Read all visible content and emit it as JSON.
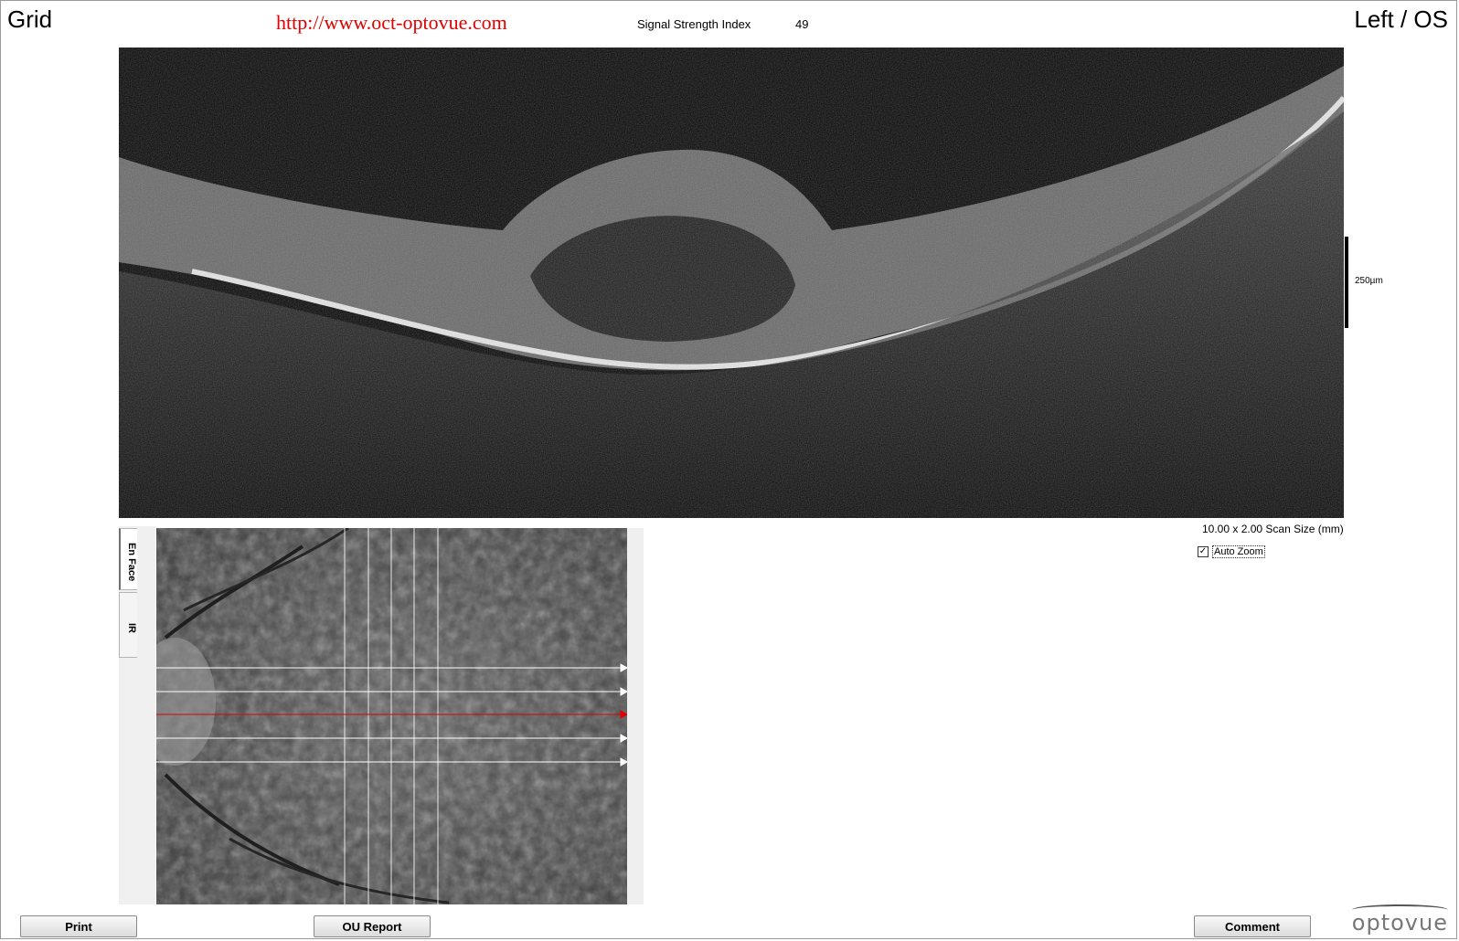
{
  "header": {
    "mode": "Grid",
    "url": "http://www.oct-optovue.com",
    "ssi_label": "Signal Strength Index",
    "ssi_value": "49",
    "eye": "Left / OS"
  },
  "bscan": {
    "scale_label": "250µm",
    "scan_size": "10.00 x 2.00 Scan Size (mm)",
    "auto_zoom_label": "Auto Zoom",
    "auto_zoom_checked": "✓"
  },
  "enface": {
    "tabs": [
      {
        "label": "En Face",
        "active": true
      },
      {
        "label": "IR",
        "active": false
      }
    ],
    "selected_line_color": "#e00000",
    "grid_line_color": "#ffffff"
  },
  "buttons": {
    "print": "Print",
    "ou_report": "OU Report",
    "comment": "Comment"
  },
  "logo": "optovue"
}
